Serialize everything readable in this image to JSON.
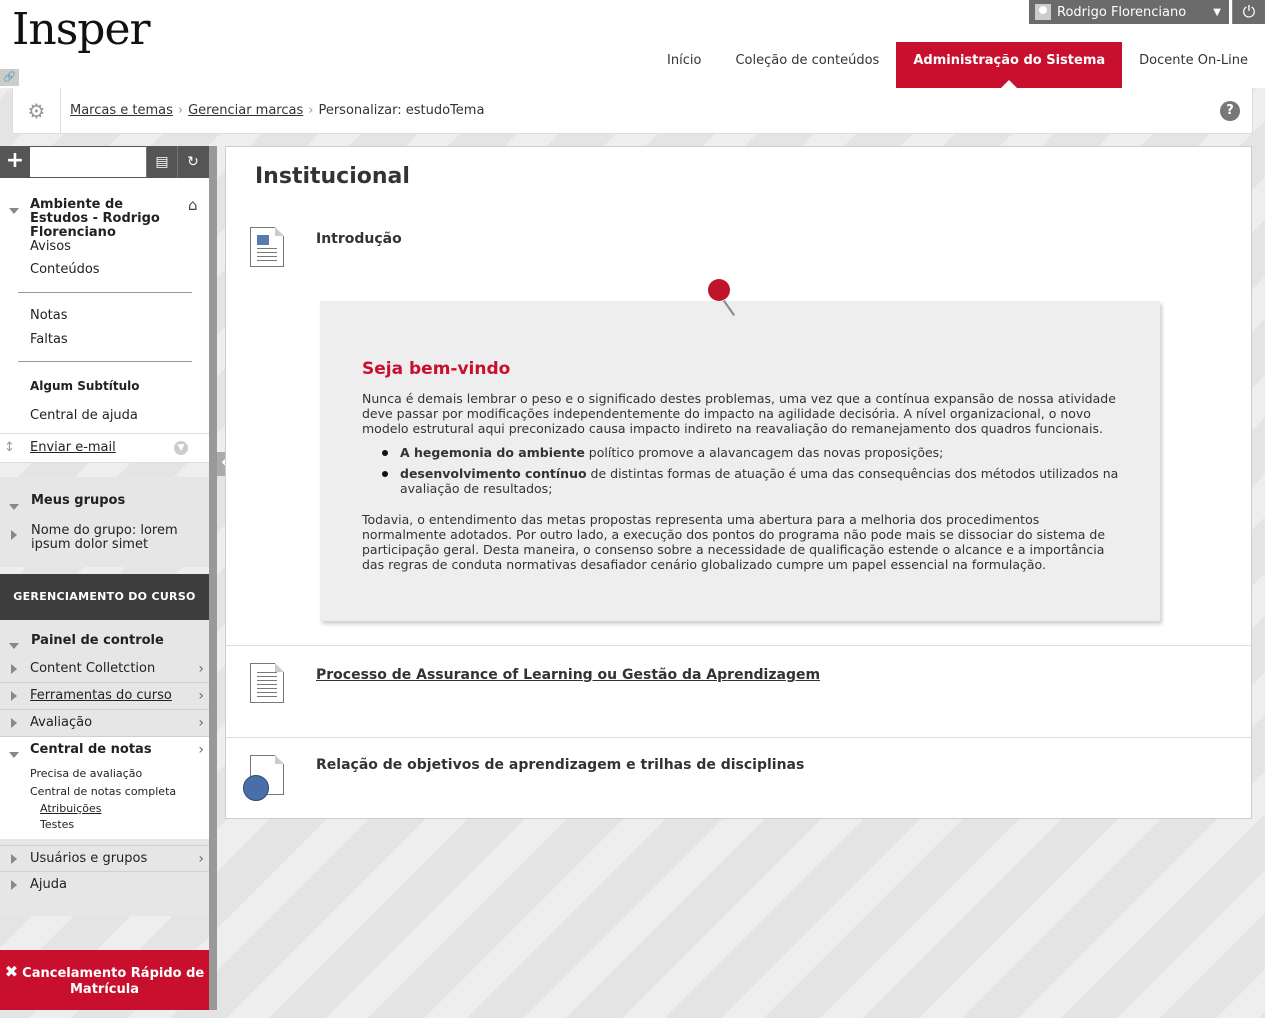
{
  "header": {
    "logo": "Insper",
    "user_name": "Rodrigo Florenciano",
    "nav": [
      "Início",
      "Coleção de conteúdos",
      "Administração do Sistema",
      "Docente On-Line"
    ]
  },
  "breadcrumb": {
    "items": [
      "Marcas e temas",
      "Gerenciar marcas",
      "Personalizar: estudoTema"
    ]
  },
  "sidebar": {
    "course_title": "Ambiente de Estudos - Rodrigo Florenciano",
    "items_a": [
      "Avisos",
      "Conteúdos"
    ],
    "items_b": [
      "Notas",
      "Faltas"
    ],
    "subtitle": "Algum Subtítulo",
    "help_center": "Central de ajuda",
    "email": "Enviar e-mail",
    "groups_title": "Meus grupos",
    "group_name": "Nome do grupo: lorem ipsum dolor simet",
    "management_title": "GERENCIAMENTO DO CURSO",
    "control_panel": "Painel de controle",
    "mgmt_items": [
      "Content Colletction",
      "Ferramentas do curso",
      "Avaliação",
      "Central de notas"
    ],
    "grade_subitems": [
      "Precisa de avaliação",
      "Central de notas completa"
    ],
    "grade_sub2": [
      "Atribuições",
      "Testes"
    ],
    "mgmt_items_b": [
      "Usuários e grupos",
      "Ajuda"
    ],
    "cancel_button": "Cancelamento Rápido de Matrícula"
  },
  "main": {
    "title": "Institucional",
    "item1_title": "Introdução",
    "welcome_title": "Seja bem-vindo",
    "para1": "Nunca é demais lembrar o peso e o significado destes problemas, uma vez que a contínua expansão de nossa atividade deve passar por modificações independentemente do impacto na agilidade decisória. A nível organizacional, o novo modelo estrutural aqui preconizado causa impacto indireto na reavaliação do remanejamento dos quadros funcionais.",
    "bullet1_bold": "A hegemonia do ambiente",
    "bullet1_rest": " político promove a alavancagem das novas proposições;",
    "bullet2_bold": "desenvolvimento contínuo",
    "bullet2_rest": " de distintas formas de atuação é uma das consequências dos métodos utilizados na avaliação de resultados;",
    "para2": "Todavia, o entendimento das metas propostas representa uma abertura para a melhoria dos procedimentos normalmente adotados. Por outro lado, a execução dos pontos do programa não pode mais  se dissociar do sistema de participação geral. Desta maneira, o consenso sobre a necessidade de qualificação estende o alcance e a importância das regras de conduta normativas desafiador cenário globalizado cumpre um papel essencial na formulação.",
    "item2_title": "Processo de Assurance of Learning ou Gestão da Aprendizagem",
    "item3_title": "Relação de objetivos de aprendizagem e trilhas de disciplinas"
  }
}
